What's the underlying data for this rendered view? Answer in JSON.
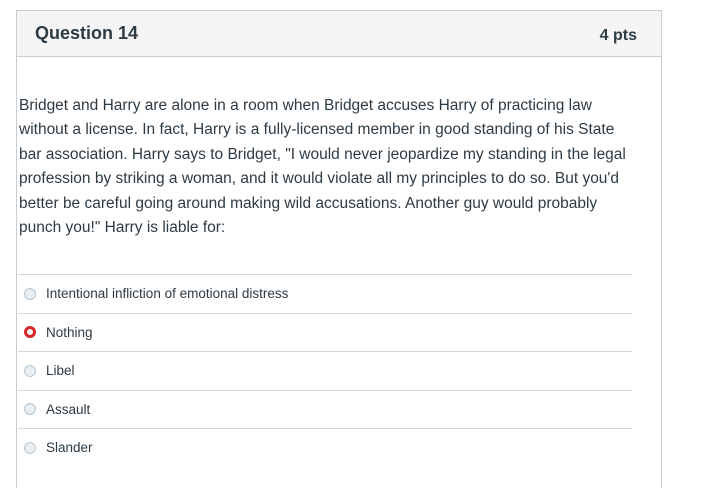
{
  "question": {
    "title": "Question 14",
    "points": "4 pts",
    "text": "Bridget and Harry are alone in a room when Bridget accuses Harry of practicing law without a license.  In fact, Harry is a fully-licensed member in good standing of his State bar association.  Harry says to Bridget, \"I would never jeopardize my standing in the legal profession by striking a woman, and it would violate all my principles to do so.  But you'd better be careful going around making wild accusations.  Another guy would probably punch you!\"  Harry is liable for:"
  },
  "answers": [
    {
      "label": "Intentional infliction of emotional distress",
      "selected": false
    },
    {
      "label": "Nothing",
      "selected": true
    },
    {
      "label": "Libel",
      "selected": false
    },
    {
      "label": "Assault",
      "selected": false
    },
    {
      "label": "Slander",
      "selected": false
    }
  ],
  "colors": {
    "selected_radio": "#d6282b",
    "header_bg": "#f5f5f5",
    "text": "#2d3b45"
  }
}
